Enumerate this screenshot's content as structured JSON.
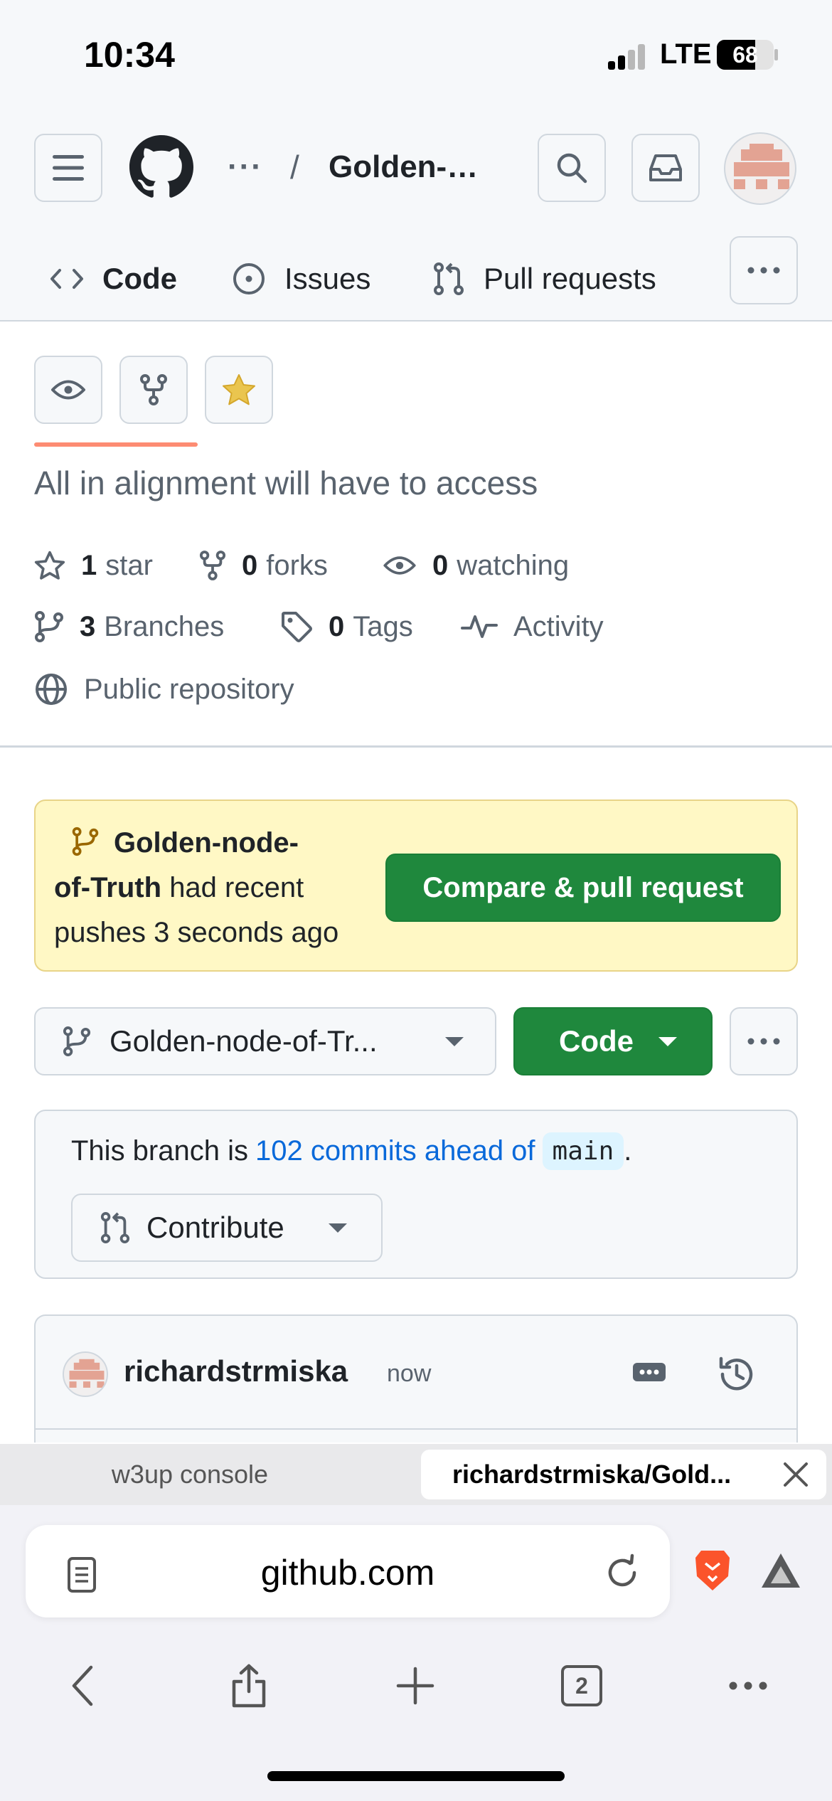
{
  "status_bar": {
    "time": "10:34",
    "network": "LTE",
    "battery": "68",
    "battery_fraction": 0.68
  },
  "header": {
    "breadcrumb_dots": "···",
    "breadcrumb_slash": "/",
    "repo_name": "Golden-…",
    "tabs": [
      {
        "label": "Code",
        "icon": "code-icon",
        "selected": true
      },
      {
        "label": "Issues",
        "icon": "issue-opened-icon"
      },
      {
        "label": "Pull requests",
        "icon": "git-pull-request-icon"
      }
    ]
  },
  "repo": {
    "description": "All in alignment will have to access",
    "stars_count": "1",
    "stars_label": "star",
    "forks_count": "0",
    "forks_label": "forks",
    "watching_count": "0",
    "watching_label": "watching",
    "branches_count": "3",
    "branches_label": "Branches",
    "tags_count": "0",
    "tags_label": "Tags",
    "activity_label": "Activity",
    "visibility_label": "Public repository"
  },
  "banner": {
    "branch_line1": "Golden-node-",
    "branch_line2": "of-Truth",
    "text_after_branch": "had recent",
    "text_line3": "pushes 3 seconds ago",
    "compare_button": "Compare & pull request"
  },
  "branch_bar": {
    "selected_branch": "Golden-node-of-Tr...",
    "code_button": "Code"
  },
  "ahead": {
    "prefix": "This branch is",
    "link": "102 commits ahead of",
    "base_branch": "main",
    "suffix": ".",
    "contribute_button": "Contribute"
  },
  "commit": {
    "author": "richardstrmiska",
    "time": "now"
  },
  "browser": {
    "tabs": [
      {
        "label": "w3up console",
        "active": false
      },
      {
        "label": "richardstrmiska/Gold...",
        "active": true
      }
    ],
    "url": "github.com",
    "open_tabs_count": "2"
  },
  "colors": {
    "primary_button": "#1f883d",
    "link": "#0969da",
    "tab_underline": "#fd8c73",
    "banner_bg": "#fff8c5",
    "star": "#eac54f"
  }
}
